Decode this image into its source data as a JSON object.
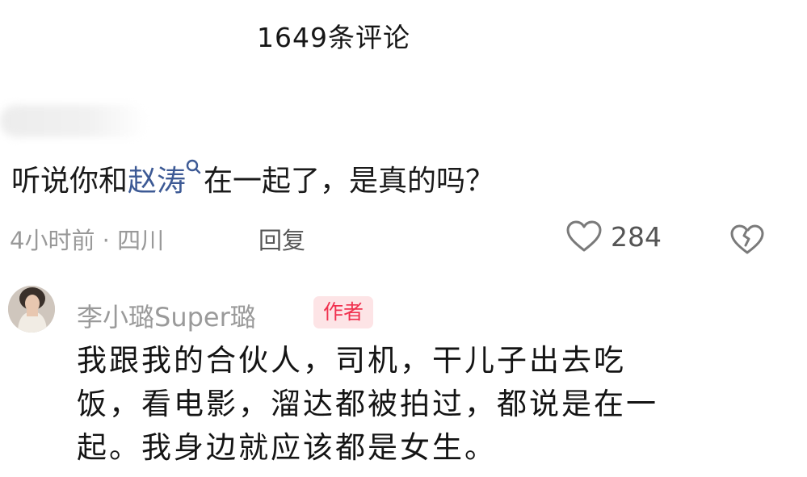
{
  "header": {
    "title": "1649条评论"
  },
  "comment": {
    "text_before": "听说你和",
    "mention": "赵涛",
    "text_after": "在一起了，是真的吗？",
    "time_location": "4小时前 · 四川",
    "reply_label": "回复",
    "like_count": "284"
  },
  "reply": {
    "author": "李小璐Super璐",
    "badge": "作者",
    "text": "我跟我的合伙人，司机，干儿子出去吃\n饭，看电影，溜达都被拍过，都说是在一\n起。我身边就应该都是女生。"
  },
  "colors": {
    "mention": "#3d5a95",
    "badge_bg": "#fde4e6",
    "badge_text": "#f0304e",
    "meta_text": "#999999"
  }
}
